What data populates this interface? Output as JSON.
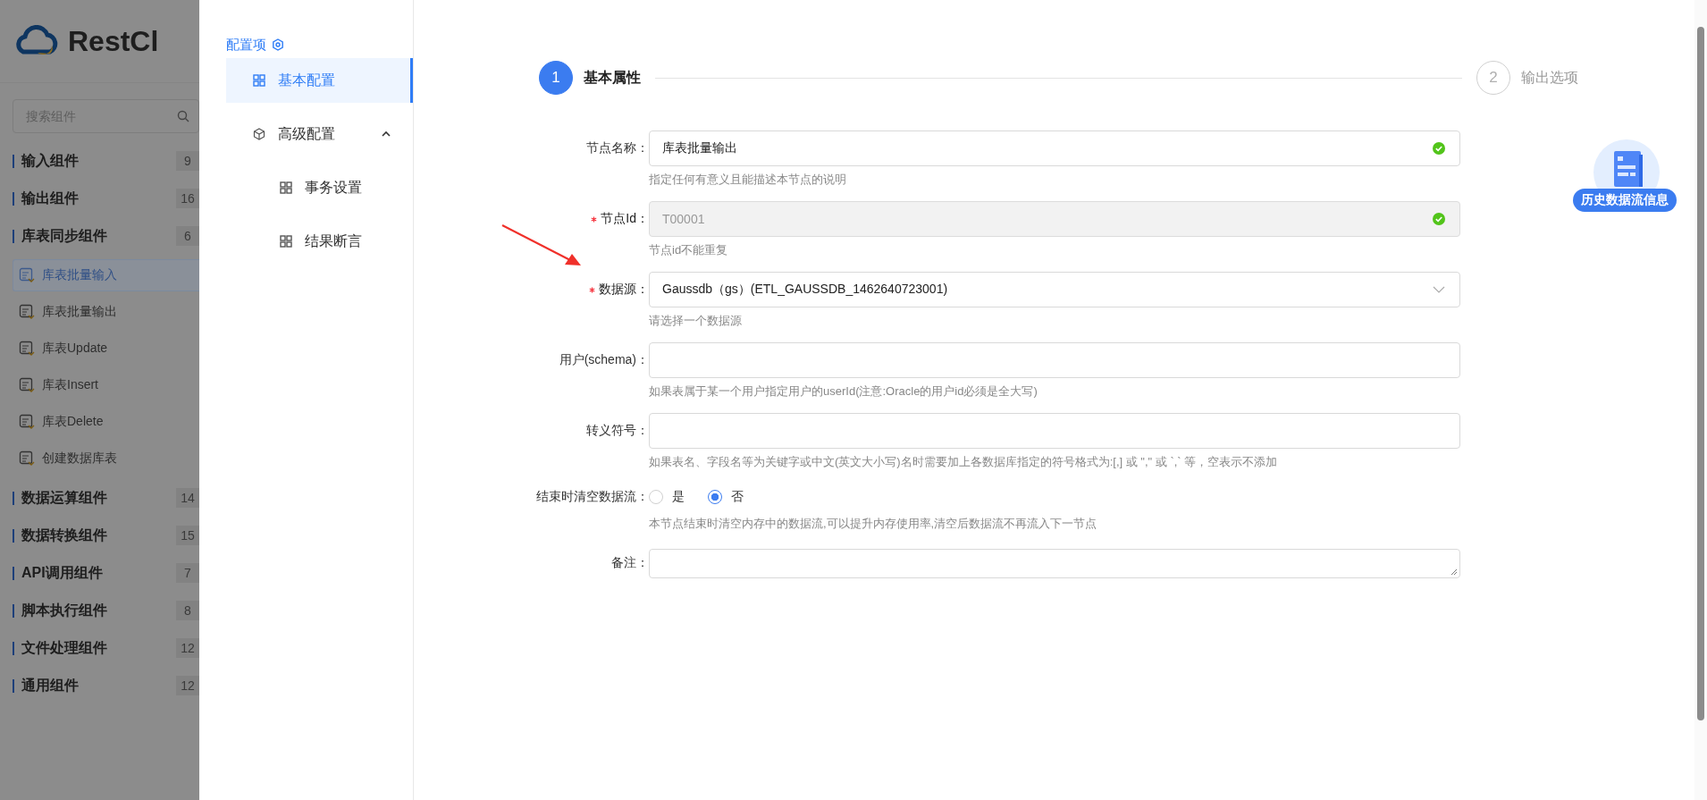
{
  "sidebar": {
    "logo_text": "RestCl",
    "search": {
      "placeholder": "搜索组件"
    },
    "groups": [
      {
        "label": "输入组件",
        "count": "9"
      },
      {
        "label": "输出组件",
        "count": "16"
      },
      {
        "label": "库表同步组件",
        "count": "6",
        "children": [
          {
            "label": "库表批量输入",
            "selected": true
          },
          {
            "label": "库表批量输出",
            "selected": false
          },
          {
            "label": "库表Update",
            "selected": false
          },
          {
            "label": "库表Insert",
            "selected": false
          },
          {
            "label": "库表Delete",
            "selected": false
          },
          {
            "label": "创建数据库表",
            "selected": false
          }
        ]
      },
      {
        "label": "数据运算组件",
        "count": "14"
      },
      {
        "label": "数据转换组件",
        "count": "15"
      },
      {
        "label": "API调用组件",
        "count": "7"
      },
      {
        "label": "脚本执行组件",
        "count": "8"
      },
      {
        "label": "文件处理组件",
        "count": "12"
      },
      {
        "label": "通用组件",
        "count": "12"
      }
    ]
  },
  "config_nav": {
    "title": "配置项",
    "items": [
      {
        "label": "基本配置",
        "selected": true
      },
      {
        "label": "高级配置",
        "selected": false,
        "expanded": true,
        "children": [
          {
            "label": "事务设置",
            "selected": false
          },
          {
            "label": "结果断言",
            "selected": false
          }
        ]
      }
    ]
  },
  "steps": [
    {
      "number": "1",
      "label": "基本属性",
      "active": true
    },
    {
      "number": "2",
      "label": "输出选项",
      "active": false
    }
  ],
  "form": [
    {
      "kind": "text",
      "label": "节点名称：",
      "required": false,
      "value": "库表批量输出",
      "disabled": false,
      "valid": true,
      "hint": "指定任何有意义且能描述本节点的说明"
    },
    {
      "kind": "text",
      "label": "节点Id：",
      "required": true,
      "value": "T00001",
      "disabled": true,
      "valid": true,
      "hint": "节点id不能重复"
    },
    {
      "kind": "select",
      "label": "数据源：",
      "required": true,
      "value": "Gaussdb（gs）(ETL_GAUSSDB_1462640723001)",
      "disabled": false,
      "valid": false,
      "hint": "请选择一个数据源"
    },
    {
      "kind": "text",
      "label": "用户(schema)：",
      "required": false,
      "disabled": false,
      "valid": false,
      "hint": "如果表属于某一个用户指定用户的userId(注意:Oracle的用户id必须是全大写)"
    },
    {
      "kind": "text",
      "label": "转义符号：",
      "required": false,
      "disabled": false,
      "valid": false,
      "hint": "如果表名、字段名等为关键字或中文(英文大小写)名时需要加上各数据库指定的符号格式为:[,] 或 \",\" 或 `,` 等，空表示不添加"
    },
    {
      "kind": "radio",
      "label": "结束时清空数据流：",
      "required": false,
      "options": [
        {
          "label": "是",
          "selected": false
        },
        {
          "label": "否",
          "selected": true
        }
      ],
      "hint": "本节点结束时清空内存中的数据流,可以提升内存使用率,清空后数据流不再流入下一节点"
    },
    {
      "kind": "textarea",
      "label": "备注：",
      "required": false
    }
  ],
  "history_badge": {
    "label": "历史数据流信息"
  }
}
